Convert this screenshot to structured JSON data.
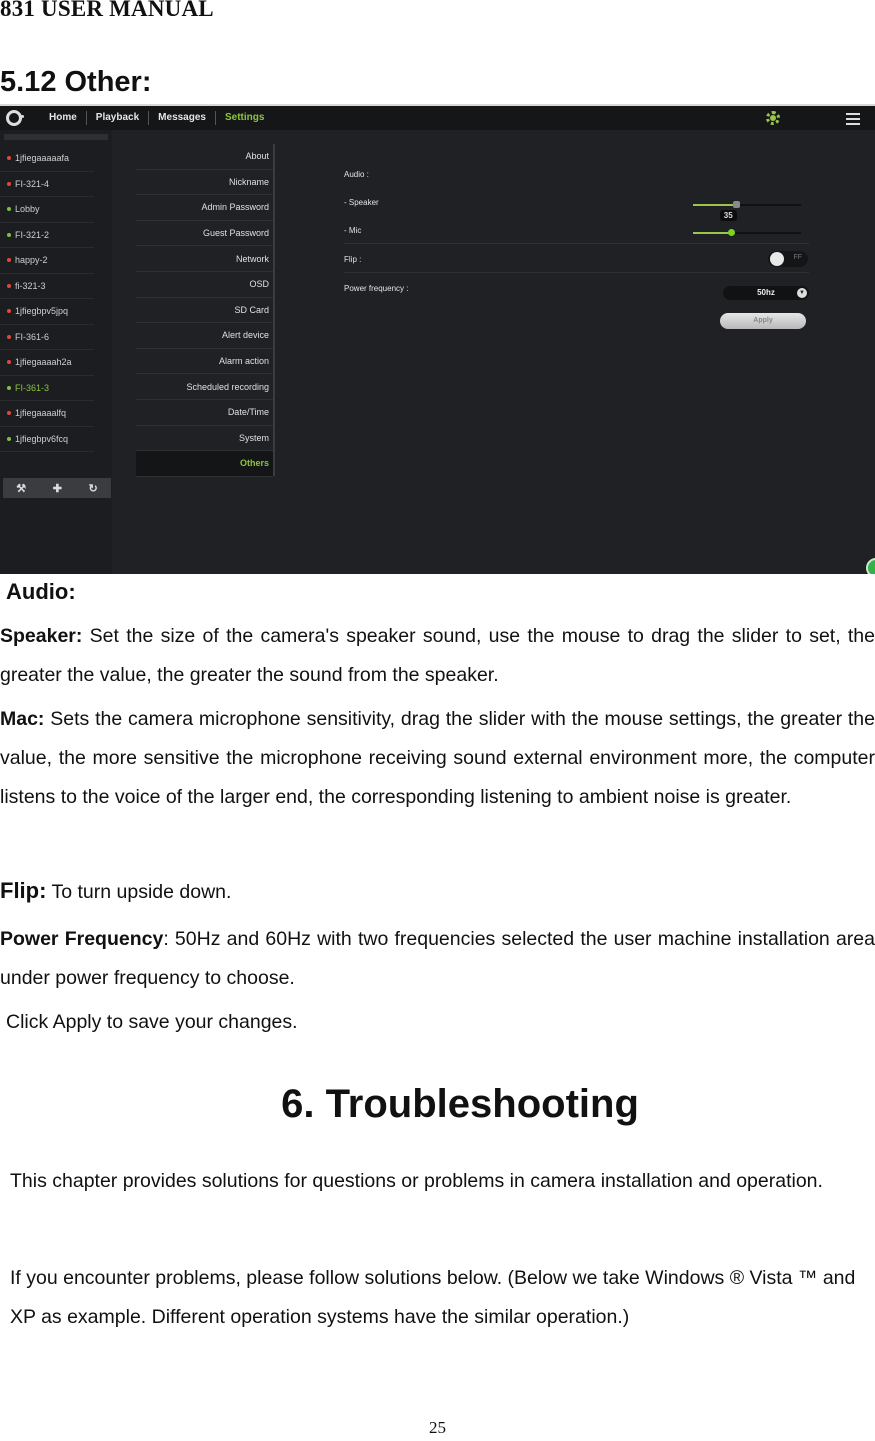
{
  "header": {
    "manual_title": "831 USER MANUAL"
  },
  "section": {
    "title": "5.12 Other:"
  },
  "app": {
    "nav_tabs": [
      {
        "label": "Home",
        "active": false
      },
      {
        "label": "Playback",
        "active": false
      },
      {
        "label": "Messages",
        "active": false
      },
      {
        "label": "Settings",
        "active": true
      }
    ],
    "top_icons": [
      "settings-gear-icon",
      "hamburger-menu-icon"
    ],
    "devices": [
      {
        "name": "1jfiegaaaaafa",
        "status": "offline"
      },
      {
        "name": "FI-321-4",
        "status": "offline"
      },
      {
        "name": "Lobby",
        "status": "online"
      },
      {
        "name": "FI-321-2",
        "status": "online"
      },
      {
        "name": "happy-2",
        "status": "offline"
      },
      {
        "name": "fi-321-3",
        "status": "offline"
      },
      {
        "name": "1jfiegbpv5jpq",
        "status": "offline"
      },
      {
        "name": "FI-361-6",
        "status": "offline"
      },
      {
        "name": "1jfiegaaaah2a",
        "status": "offline"
      },
      {
        "name": "FI-361-3",
        "status": "online",
        "selected": true
      },
      {
        "name": "1jfiegaaaalfq",
        "status": "offline"
      },
      {
        "name": "1jfiegbpv6fcq",
        "status": "online"
      }
    ],
    "status_colors": {
      "online": "#7cc242",
      "offline": "#e0473a",
      "accent": "#8cc63f"
    },
    "device_toolbar": [
      {
        "icon": "wrench-icon",
        "glyph": "⚒"
      },
      {
        "icon": "plus-icon",
        "glyph": "✚"
      },
      {
        "icon": "refresh-icon",
        "glyph": "↻"
      }
    ],
    "settings_menu": [
      {
        "label": "About"
      },
      {
        "label": "Nickname"
      },
      {
        "label": "Admin Password"
      },
      {
        "label": "Guest Password"
      },
      {
        "label": "Network"
      },
      {
        "label": "OSD"
      },
      {
        "label": "SD Card"
      },
      {
        "label": "Alert device"
      },
      {
        "label": "Alarm action"
      },
      {
        "label": "Scheduled recording"
      },
      {
        "label": "Date/Time"
      },
      {
        "label": "System"
      },
      {
        "label": "Others",
        "active": true
      }
    ],
    "panel": {
      "audio_label": "Audio :",
      "speaker_label": "- Speaker",
      "speaker_value_pct": 40,
      "mic_label": "- Mic",
      "mic_value": 35,
      "mic_value_pct": 35,
      "flip_label": "Flip :",
      "flip_state": "FF",
      "power_frequency_label": "Power frequency :",
      "power_frequency_value": "50hz",
      "apply_label": "Apply"
    }
  },
  "doc": {
    "audio_heading": "Audio:",
    "speaker_term": "Speaker:",
    "speaker_text": " Set the size of the camera's speaker sound, use the mouse to drag the slider to set, the greater the value, the greater the sound from the speaker.",
    "mic_term": "Mac:",
    "mic_text": " Sets the camera microphone sensitivity, drag the slider with the mouse settings, the greater the value, the more sensitive the microphone receiving sound external environment more, the computer listens to the voice of the larger end, the corresponding listening to ambient noise is greater.",
    "flip_term": "Flip:",
    "flip_text": " To turn upside down.",
    "power_term": "Power Frequency",
    "power_text": ": 50Hz and 60Hz with two frequencies selected the user machine installation area under power frequency to choose.",
    "apply_note": "Click Apply to save your changes.",
    "chapter_title": "6. Troubleshooting",
    "chapter_intro": "This chapter provides solutions for questions or problems in camera installation and operation.",
    "chapter_note": "If you encounter problems, please follow solutions below. (Below we take Windows ® Vista ™ and XP as example. Different operation systems have the similar operation.)",
    "page_number": "25"
  }
}
